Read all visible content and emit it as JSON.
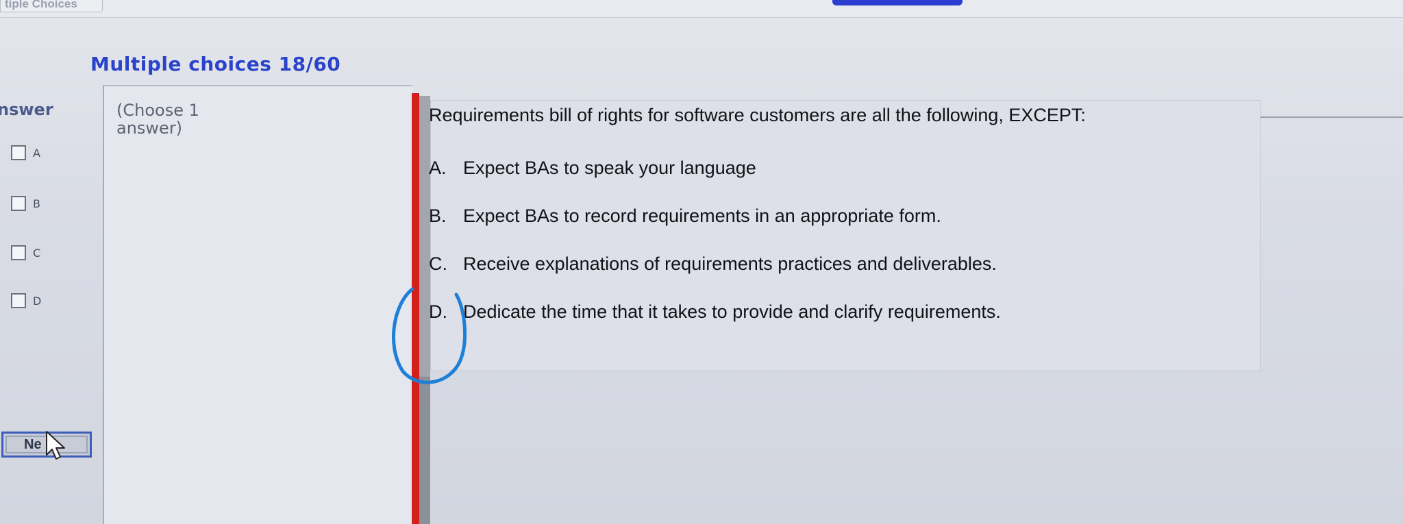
{
  "top_tab": {
    "label": "tiple Choices"
  },
  "header": {
    "title": "Multiple choices 18/60"
  },
  "answer_panel": {
    "label": "nswer",
    "options": [
      "A",
      "B",
      "C",
      "D"
    ],
    "next_button": "Ne"
  },
  "hint": {
    "text": "(Choose 1 answer)"
  },
  "question": {
    "text": "Requirements bill of rights for software customers are all the following, EXCEPT:",
    "answers": [
      {
        "letter": "A.",
        "text": "Expect BAs to speak your language"
      },
      {
        "letter": "B.",
        "text": "Expect BAs to record requirements in an appropriate form."
      },
      {
        "letter": "C.",
        "text": "Receive explanations of requirements practices and deliverables."
      },
      {
        "letter": "D.",
        "text": "Dedicate the time that it takes to provide and clarify requirements."
      }
    ]
  },
  "colors": {
    "title": "#2a43c8",
    "divider": "#d4201c",
    "circle_annotation": "#1f7fd6",
    "next_border": "#3d5db8"
  },
  "icons": {
    "checkbox": "checkbox-icon",
    "cursor": "mouse-cursor-icon"
  }
}
